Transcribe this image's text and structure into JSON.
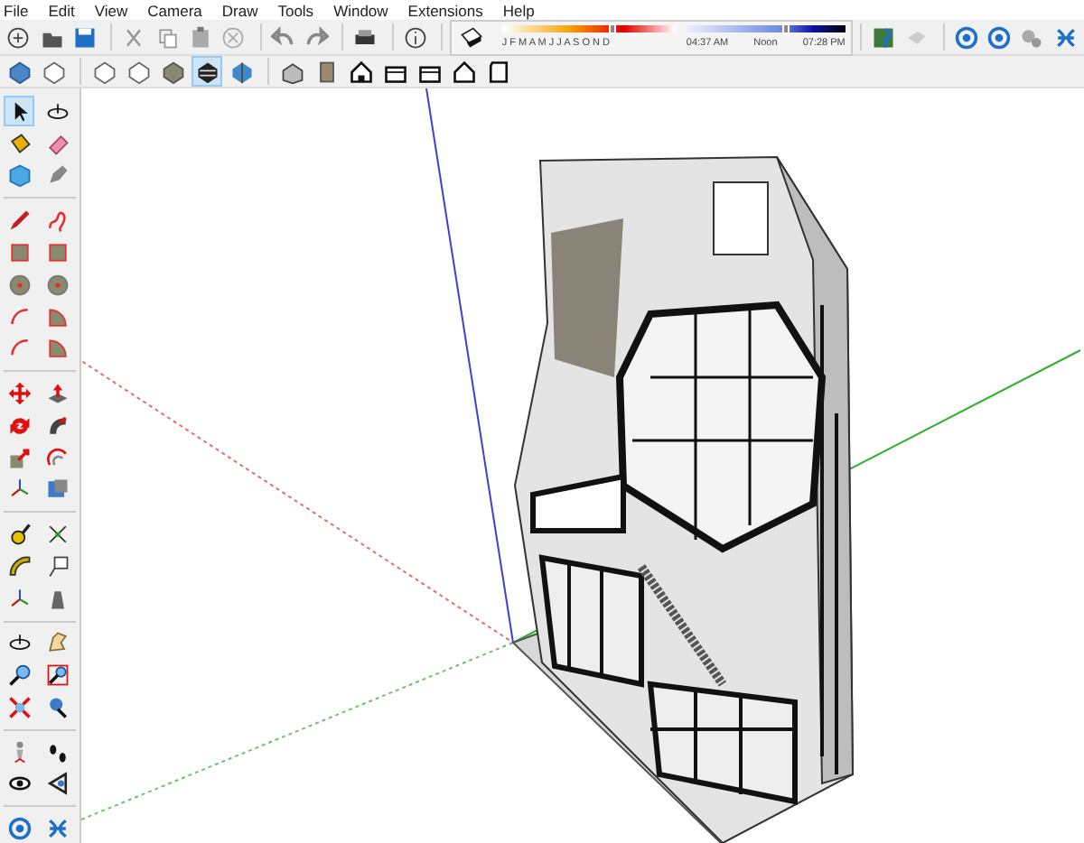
{
  "menu": [
    "File",
    "Edit",
    "View",
    "Camera",
    "Draw",
    "Tools",
    "Window",
    "Extensions",
    "Help"
  ],
  "shadow_settings": {
    "month_slider": {
      "months": "J F M A M J J A S O N D",
      "level": 0.62
    },
    "time_slider": {
      "labels": [
        "04:37 AM",
        "Noon",
        "07:28 PM"
      ],
      "level": 0.6
    }
  },
  "style_buttons": [
    {
      "selected": false
    },
    {
      "selected": false
    },
    {
      "selected": false
    },
    {
      "selected": false
    },
    {
      "selected": false
    },
    {
      "selected": true
    },
    {
      "selected": false
    }
  ],
  "tool_palette": [
    {
      "selected": true
    },
    {
      "selected": false
    },
    {
      "selected": false
    },
    {
      "selected": false
    },
    {
      "selected": false
    },
    {
      "selected": false
    },
    {
      "selected": false
    },
    {
      "selected": false
    },
    {
      "selected": false
    },
    {
      "selected": false
    },
    {
      "selected": false
    },
    {
      "selected": false
    },
    {
      "selected": false
    },
    {
      "selected": false
    },
    {
      "selected": false
    },
    {
      "selected": false
    },
    {
      "selected": false
    },
    {
      "selected": false
    },
    {
      "selected": false
    },
    {
      "selected": false
    },
    {
      "selected": false
    },
    {
      "selected": false
    },
    {
      "selected": false
    },
    {
      "selected": false
    },
    {
      "selected": false
    },
    {
      "selected": false
    },
    {
      "selected": false
    },
    {
      "selected": false
    },
    {
      "selected": false
    },
    {
      "selected": false
    },
    {
      "selected": false
    },
    {
      "selected": false
    },
    {
      "selected": false
    },
    {
      "selected": false
    },
    {
      "selected": false
    },
    {
      "selected": false
    },
    {
      "selected": false
    },
    {
      "selected": false
    },
    {
      "selected": false
    },
    {
      "selected": false
    },
    {
      "selected": false
    },
    {
      "selected": false
    }
  ]
}
